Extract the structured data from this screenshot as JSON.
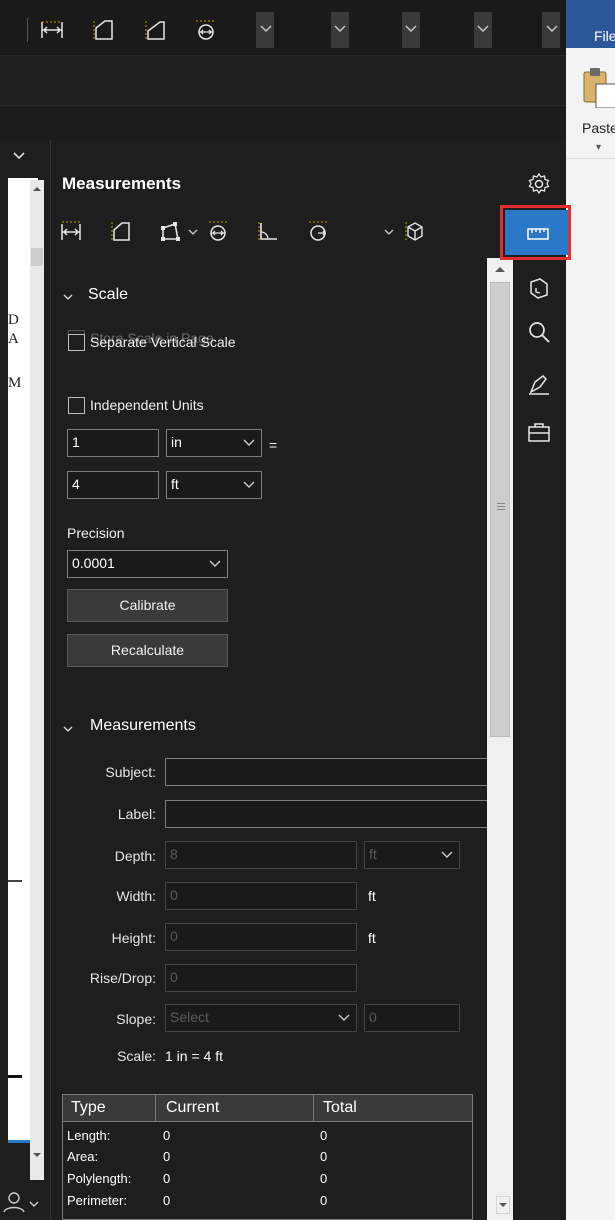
{
  "toolbar": {
    "icons": [
      "length-tool-icon",
      "area-tool-icon",
      "polygon-area-tool-icon",
      "diameter-tool-icon"
    ],
    "dropdowns": [
      "chevron-down-icon",
      "chevron-down-icon",
      "chevron-down-icon",
      "chevron-down-icon",
      "chevron-down-icon"
    ]
  },
  "word": {
    "file_tab": "File",
    "paste_label": "Paste"
  },
  "panel": {
    "title": "Measurements",
    "tools": [
      "length-tool-icon",
      "area-tool-icon",
      "polyline-tool-icon",
      "diameter-tool-icon",
      "angle-tool-icon",
      "radius-tool-icon",
      "volume-tool-icon"
    ]
  },
  "scale": {
    "heading": "Scale",
    "store_scale_label": "Store Scale in Page",
    "separate_vertical_label": "Separate Vertical Scale",
    "independent_units_label": "Independent Units",
    "doc_value": "1",
    "doc_unit": "in",
    "equals": "=",
    "real_value": "4",
    "real_unit": "ft",
    "precision_label": "Precision",
    "precision_value": "0.0001",
    "calibrate_label": "Calibrate",
    "recalculate_label": "Recalculate"
  },
  "measurements": {
    "heading": "Measurements",
    "subject_label": "Subject:",
    "subject_value": "",
    "label_label": "Label:",
    "label_value": "",
    "depth_label": "Depth:",
    "depth_value": "8",
    "depth_unit": "ft",
    "width_label": "Width:",
    "width_value": "0",
    "width_unit": "ft",
    "height_label": "Height:",
    "height_value": "0",
    "height_unit": "ft",
    "rise_label": "Rise/Drop:",
    "rise_value": "0",
    "slope_label": "Slope:",
    "slope_placeholder": "Select",
    "slope_value": "0",
    "scale_label": "Scale:",
    "scale_value": "1 in = 4 ft"
  },
  "results": {
    "headers": [
      "Type",
      "Current",
      "Total"
    ],
    "rows": [
      {
        "type": "Length:",
        "current": "0",
        "total": "0"
      },
      {
        "type": "Area:",
        "current": "0",
        "total": "0"
      },
      {
        "type": "Polylength:",
        "current": "0",
        "total": "0"
      },
      {
        "type": "Perimeter:",
        "current": "0",
        "total": "0"
      }
    ]
  },
  "sidebar": {
    "items": [
      "settings-gear-icon",
      "measure-ruler-icon",
      "layers-icon",
      "search-icon",
      "markup-pen-icon",
      "toolbox-icon"
    ]
  },
  "doc": {
    "glyphs": [
      "D",
      "A",
      "M"
    ]
  },
  "colors": {
    "accent": "#2b78c8",
    "highlight": "#e0302f",
    "word_blue": "#2b579a"
  }
}
